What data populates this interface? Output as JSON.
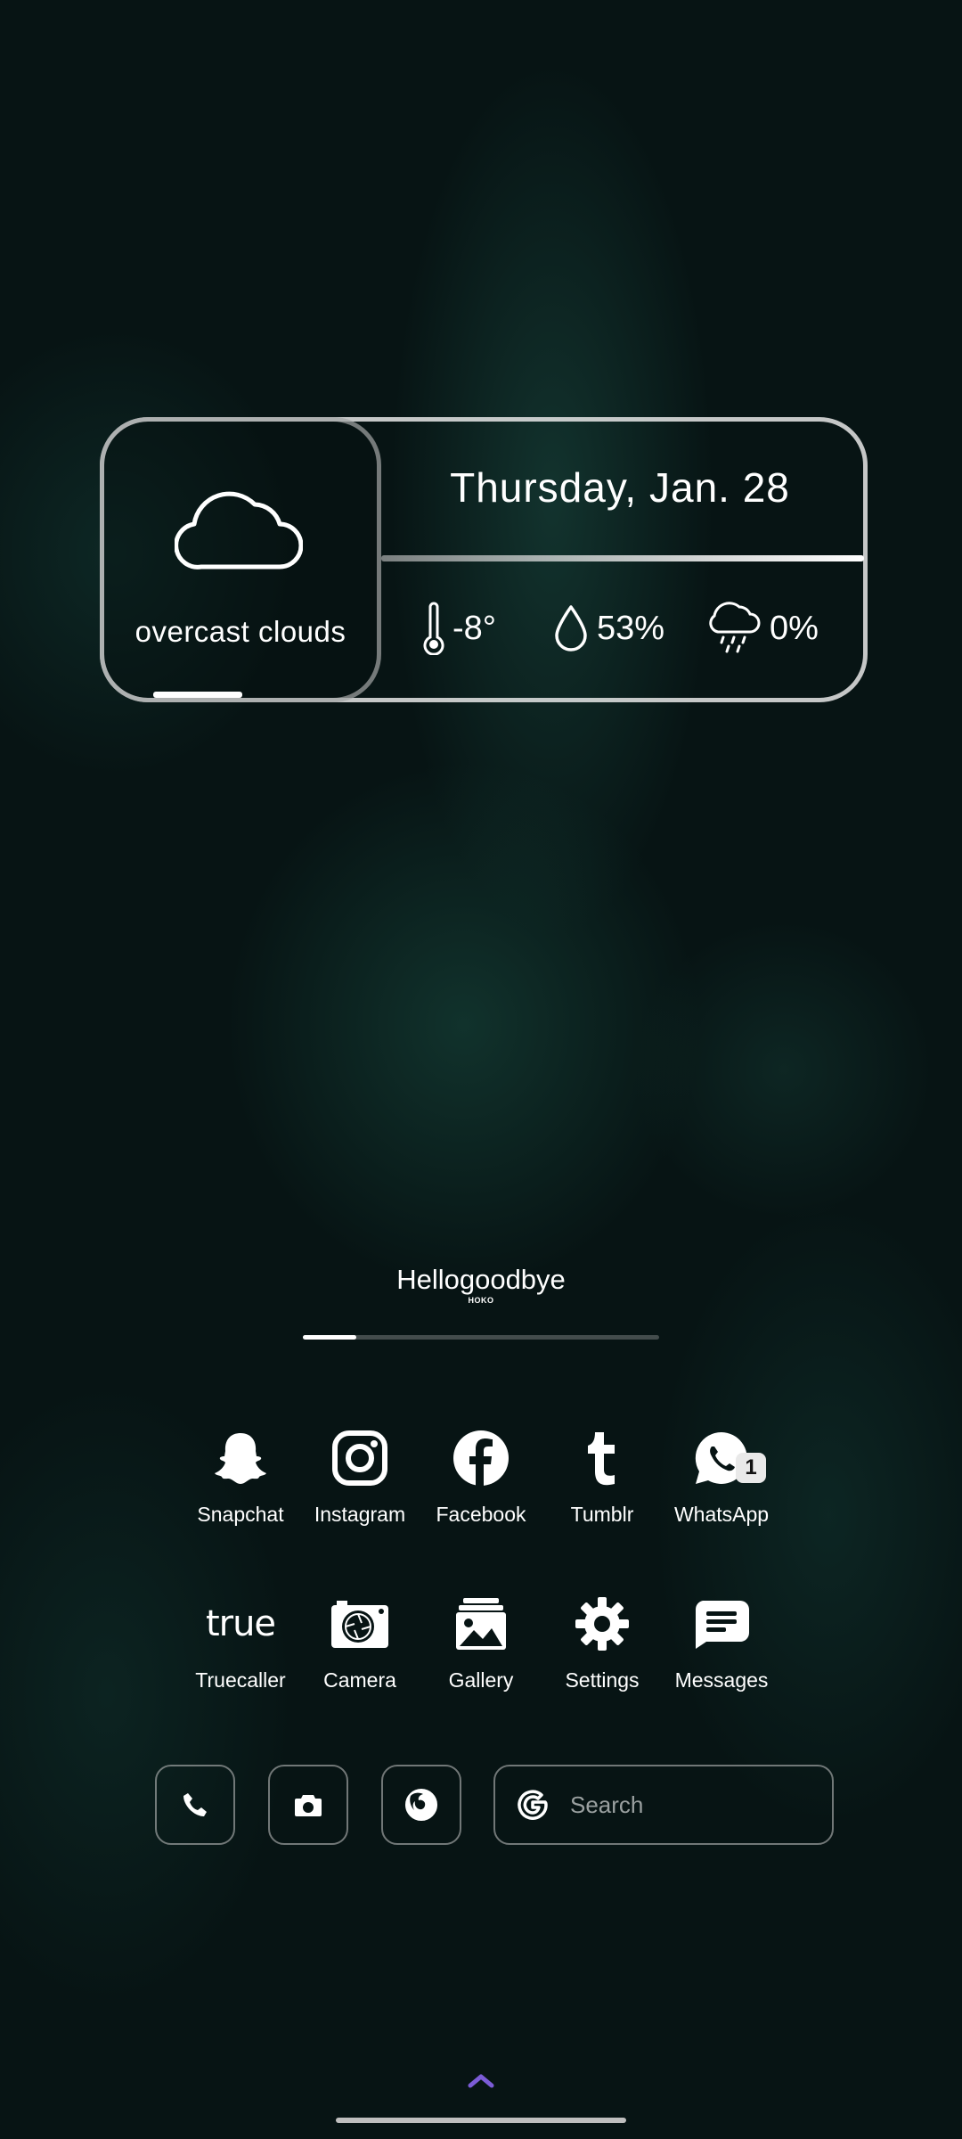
{
  "weather": {
    "description": "overcast clouds",
    "date": "Thursday, Jan. 28",
    "temperature": "-8°",
    "humidity": "53%",
    "precipitation": "0%"
  },
  "music": {
    "title": "Hellogoodbye",
    "artist": "HOKO",
    "progress": 0.15
  },
  "apps_row1": [
    {
      "label": "Snapchat",
      "icon": "snapchat-icon"
    },
    {
      "label": "Instagram",
      "icon": "instagram-icon"
    },
    {
      "label": "Facebook",
      "icon": "facebook-icon"
    },
    {
      "label": "Tumblr",
      "icon": "tumblr-icon"
    },
    {
      "label": "WhatsApp",
      "icon": "whatsapp-icon",
      "badge": "1"
    }
  ],
  "apps_row2": [
    {
      "label": "Truecaller",
      "icon": "truecaller-icon",
      "glyph": "true"
    },
    {
      "label": "Camera",
      "icon": "camera-icon"
    },
    {
      "label": "Gallery",
      "icon": "gallery-icon"
    },
    {
      "label": "Settings",
      "icon": "gear-icon"
    },
    {
      "label": "Messages",
      "icon": "messages-icon"
    }
  ],
  "dock": {
    "search_placeholder": "Search",
    "items": [
      "phone-icon",
      "camera-icon",
      "firefox-icon",
      "google-icon"
    ]
  },
  "colors": {
    "accent_arrow": "#7b5cd6",
    "background": "#071414"
  }
}
